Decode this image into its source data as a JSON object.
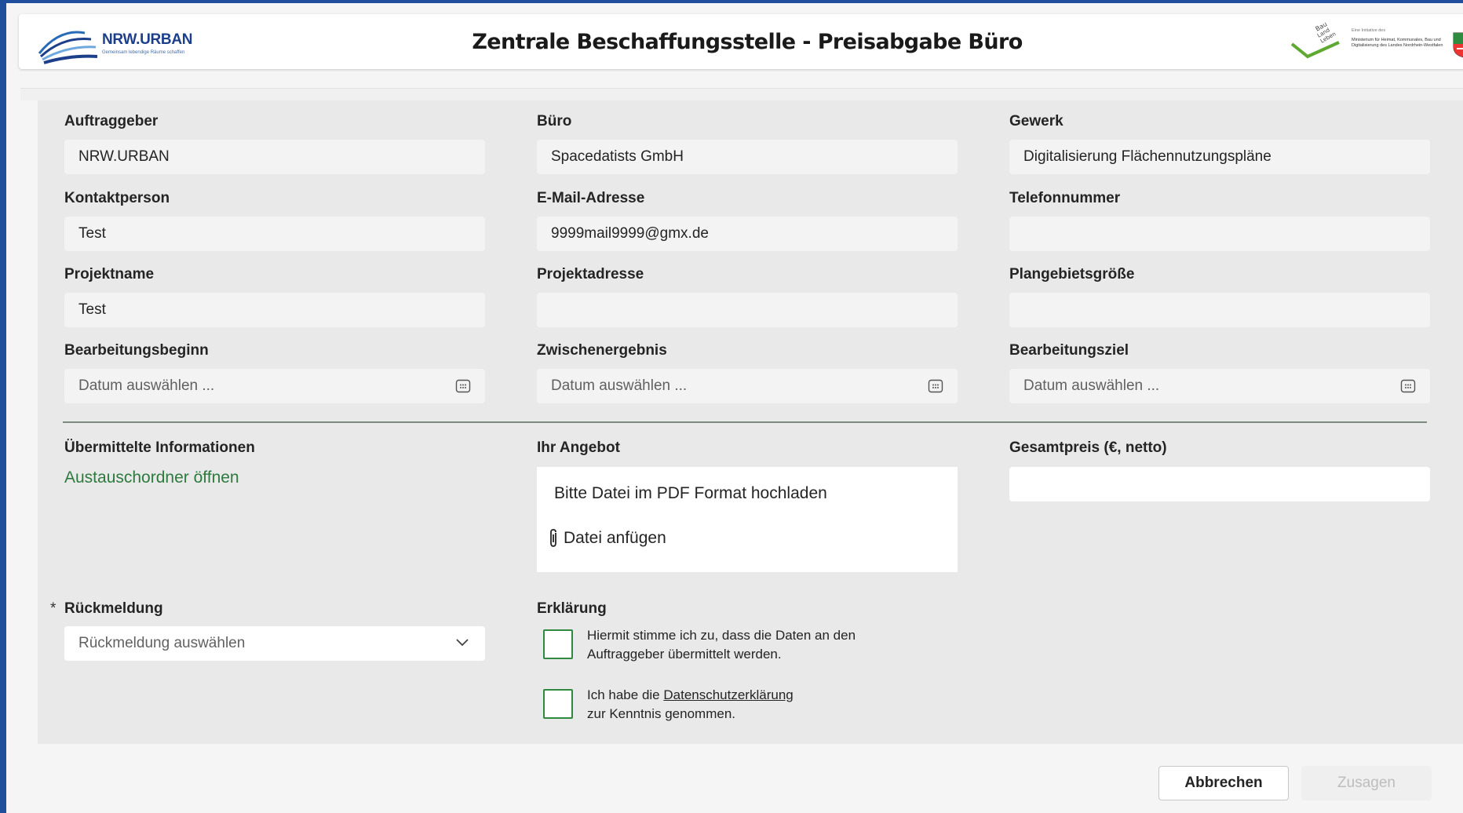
{
  "header": {
    "title": "Zentrale Beschaffungsstelle - Preisabgabe Büro",
    "brand_name": "NRW.URBAN",
    "brand_tagline": "Gemeinsam lebendige Räume schaffen",
    "partner_intro": "Eine Initiative des",
    "partner_text": "Ministerium für Heimat, Kommunales, Bau und Digitalisierung des Landes Nordrhein-Westfalen",
    "bauland_logo_text": "Bau Land Leben"
  },
  "fields": {
    "auftraggeber": {
      "label": "Auftraggeber",
      "value": "NRW.URBAN"
    },
    "buero": {
      "label": "Büro",
      "value": "Spacedatists GmbH"
    },
    "gewerk": {
      "label": "Gewerk",
      "value": "Digitalisierung Flächennutzungspläne"
    },
    "kontaktperson": {
      "label": "Kontaktperson",
      "value": "Test"
    },
    "email": {
      "label": "E-Mail-Adresse",
      "value": "9999mail9999@gmx.de"
    },
    "telefon": {
      "label": "Telefonnummer",
      "value": ""
    },
    "projektname": {
      "label": "Projektname",
      "value": "Test"
    },
    "projektadresse": {
      "label": "Projektadresse",
      "value": ""
    },
    "plangebietsgroesse": {
      "label": "Plangebietsgröße",
      "value": ""
    },
    "bearbeitungsbeginn": {
      "label": "Bearbeitungsbeginn",
      "placeholder": "Datum auswählen ..."
    },
    "zwischenergebnis": {
      "label": "Zwischenergebnis",
      "placeholder": "Datum auswählen ..."
    },
    "bearbeitungsziel": {
      "label": "Bearbeitungsziel",
      "placeholder": "Datum auswählen ..."
    }
  },
  "info": {
    "label": "Übermittelte Informationen",
    "link": "Austauschordner öffnen"
  },
  "offer": {
    "label": "Ihr Angebot",
    "hint": "Bitte Datei im PDF Format hochladen",
    "attach": "Datei anfügen"
  },
  "price": {
    "label": "Gesamtpreis (€, netto)",
    "value": ""
  },
  "feedback": {
    "required_marker": "*",
    "label": "Rückmeldung",
    "placeholder": "Rückmeldung auswählen"
  },
  "declaration": {
    "label": "Erklärung",
    "consent_line1": "Hiermit stimme ich zu, dass die Daten an den",
    "consent_line2": "Auftraggeber übermittelt werden.",
    "privacy_prefix": "Ich habe die ",
    "privacy_link": "Datenschutzerklärung",
    "privacy_line2": "zur Kenntnis genommen.",
    "consent_checked": false,
    "privacy_checked": false
  },
  "actions": {
    "cancel": "Abbrechen",
    "submit": "Zusagen"
  },
  "colors": {
    "frame_border": "#1f4e9c",
    "link_green": "#2c7a3d",
    "checkbox_green": "#2f8a3f",
    "panel_bg": "#e9e9e9"
  }
}
